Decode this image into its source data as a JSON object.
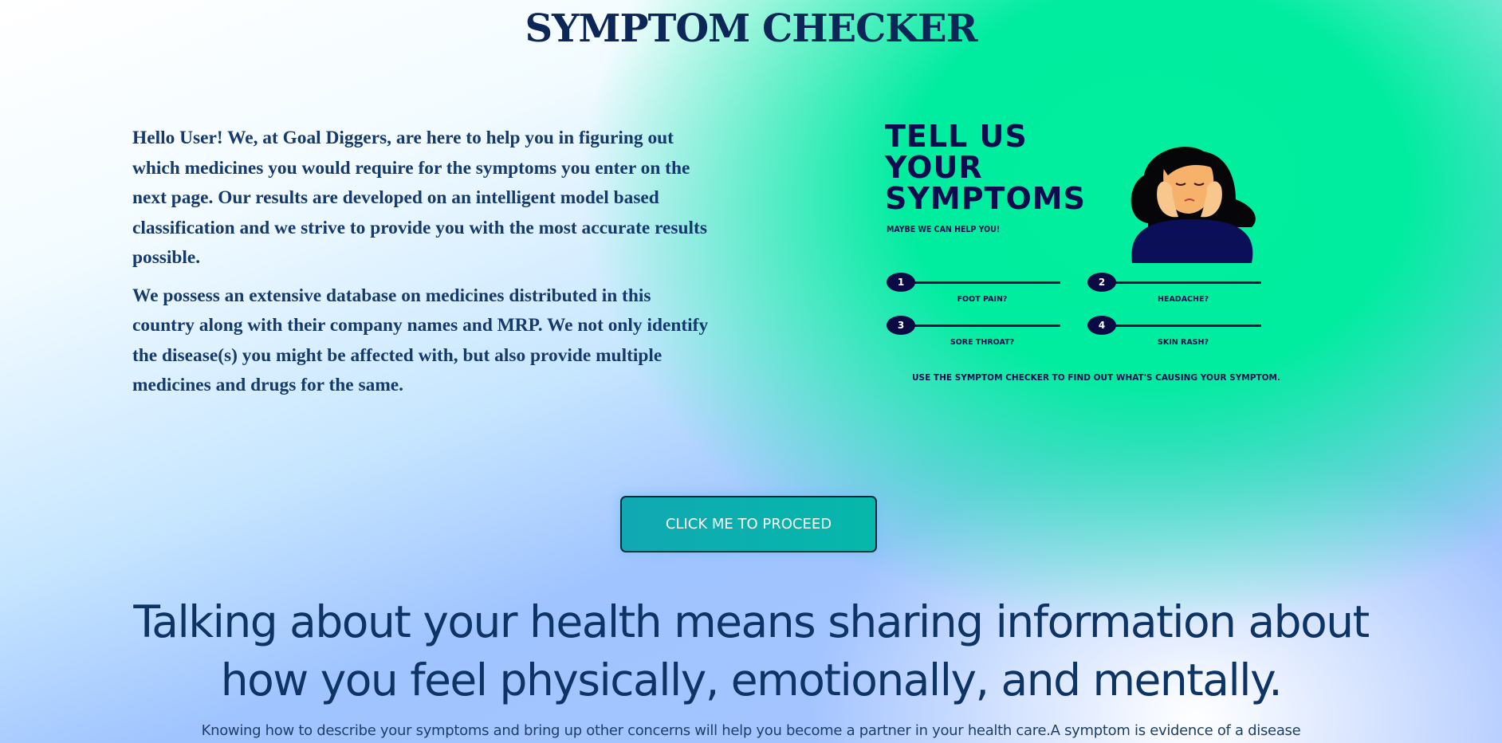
{
  "page": {
    "title": "SYMPTOM CHECKER"
  },
  "intro": {
    "paragraph1": "Hello User! We, at Goal Diggers, are here to help you in figuring out which medicines you would require for the symptoms you enter on the next page. Our results are developed on an intelligent model based classification and we strive to provide you with the most accurate results possible.",
    "paragraph2": "We possess an extensive database on medicines distributed in this country along with their company names and MRP. We not only identify the disease(s) you might be affected with, but also provide multiple medicines and drugs for the same."
  },
  "poster": {
    "heading_line1": "TELL US",
    "heading_line2": "YOUR",
    "heading_line3": "SYMPTOMS",
    "subheading": "MAYBE WE CAN HELP YOU!",
    "steps": [
      {
        "number": "1",
        "label": "FOOT PAIN?"
      },
      {
        "number": "2",
        "label": "HEADACHE?"
      },
      {
        "number": "3",
        "label": "SORE THROAT?"
      },
      {
        "number": "4",
        "label": "SKIN RASH?"
      }
    ],
    "footer": "USE THE SYMPTOM CHECKER TO FIND OUT WHAT'S CAUSING YOUR SYMPTOM.",
    "illustration_icon": "worried-woman-illustration"
  },
  "cta": {
    "label": "CLICK ME TO PROCEED"
  },
  "quote": {
    "line1": "Talking about your health means sharing information about",
    "line2": "how you feel physically, emotionally, and mentally."
  },
  "description": "Knowing how to describe your symptoms and bring up other concerns will help you become a partner in your health care.A symptom is evidence of a disease",
  "colors": {
    "heading": "#0c2757",
    "poster_bg": "#00ec9f",
    "poster_ink": "#0e0c4f",
    "button": "#06b8aa"
  }
}
